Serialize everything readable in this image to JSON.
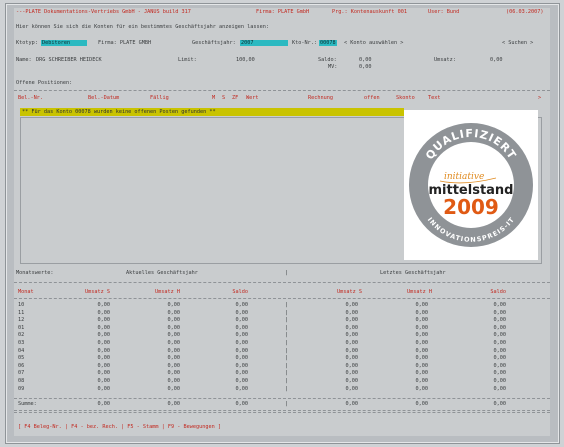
{
  "titlebar": {
    "left": "---PLATE Dokumentations-Vertriebs GmbH - JANUS build 317",
    "firma": "Firma: PLATE GmbH",
    "prg": "Prg.: Kontenauskunft 001",
    "user": "User: Bund",
    "date": "(06.03.2007)"
  },
  "info_line": "Hier können Sie sich die Konten für ein bestimmtes Geschäftsjahr anzeigen lassen:",
  "form": {
    "ktotyp_label": "Ktotyp:",
    "ktotyp_value": "Debitoren",
    "firma_label": "Firma: PLATE GMBH",
    "gj_label": "Geschäftsjahr:",
    "gj_value": "2007",
    "kto_label": "Kto-Nr.:",
    "kto_value": "00078",
    "konto_choose": "< Konto auswählen >",
    "suchen": "< Suchen >"
  },
  "name_row": {
    "name_label": "Name:",
    "name_value": "DRG SCHREIBER HEIDECK",
    "limit_label": "Limit:",
    "limit_value": "100,00",
    "saldo_label": "Saldo:",
    "saldo_value": "0,00",
    "umsatz_label": "Umsatz:",
    "umsatz_value": "0,00",
    "mv_label": "MV:",
    "mv_value": "0,00"
  },
  "offene": {
    "title": "Offene Positionen:",
    "headers": [
      "Bel.-Nr.",
      "Bel.-Datum",
      "Fällig",
      "M",
      "S",
      "ZF",
      "Wert",
      "Rechnung",
      "offen",
      "Skonto",
      "Text"
    ],
    "message": "** Für das Konto 00078 wurden keine offenen Posten gefunden **"
  },
  "logo": {
    "top_text": "QUALIFIZIERT",
    "initiative": "initiative",
    "mittelstand": "mittelstand",
    "year": "2009",
    "bottom_text": "INNOVATIONSPREIS-IT"
  },
  "monthly": {
    "title": "Monatswerte:",
    "current_label": "Aktuelles Geschäftsjahr",
    "divider": "|",
    "last_label": "Letztes Geschäftsjahr",
    "headers": [
      "Monat",
      "Umsatz S",
      "Umsatz H",
      "Saldo",
      "Umsatz S",
      "Umsatz H",
      "Saldo"
    ],
    "rows": [
      {
        "m": "10",
        "v": [
          "0,00",
          "0,00",
          "0,00",
          "0,00",
          "0,00",
          "0,00"
        ]
      },
      {
        "m": "11",
        "v": [
          "0,00",
          "0,00",
          "0,00",
          "0,00",
          "0,00",
          "0,00"
        ]
      },
      {
        "m": "12",
        "v": [
          "0,00",
          "0,00",
          "0,00",
          "0,00",
          "0,00",
          "0,00"
        ]
      },
      {
        "m": "01",
        "v": [
          "0,00",
          "0,00",
          "0,00",
          "0,00",
          "0,00",
          "0,00"
        ]
      },
      {
        "m": "02",
        "v": [
          "0,00",
          "0,00",
          "0,00",
          "0,00",
          "0,00",
          "0,00"
        ]
      },
      {
        "m": "03",
        "v": [
          "0,00",
          "0,00",
          "0,00",
          "0,00",
          "0,00",
          "0,00"
        ]
      },
      {
        "m": "04",
        "v": [
          "0,00",
          "0,00",
          "0,00",
          "0,00",
          "0,00",
          "0,00"
        ]
      },
      {
        "m": "05",
        "v": [
          "0,00",
          "0,00",
          "0,00",
          "0,00",
          "0,00",
          "0,00"
        ]
      },
      {
        "m": "06",
        "v": [
          "0,00",
          "0,00",
          "0,00",
          "0,00",
          "0,00",
          "0,00"
        ]
      },
      {
        "m": "07",
        "v": [
          "0,00",
          "0,00",
          "0,00",
          "0,00",
          "0,00",
          "0,00"
        ]
      },
      {
        "m": "08",
        "v": [
          "0,00",
          "0,00",
          "0,00",
          "0,00",
          "0,00",
          "0,00"
        ]
      },
      {
        "m": "09",
        "v": [
          "0,00",
          "0,00",
          "0,00",
          "0,00",
          "0,00",
          "0,00"
        ]
      }
    ],
    "sum_label": "Summe:",
    "sum": [
      "0,00",
      "0,00",
      "0,00",
      "0,00",
      "0,00",
      "0,00"
    ]
  },
  "footer": "[ F4 Beleg-Nr. | F4 - bez. Rech. | F5 - Stamm | F9 - Bewegungen ]",
  "colors": {
    "accent_red": "#c2281f",
    "cyan": "#2bb9c1",
    "banner_yellow": "#c9c300"
  }
}
